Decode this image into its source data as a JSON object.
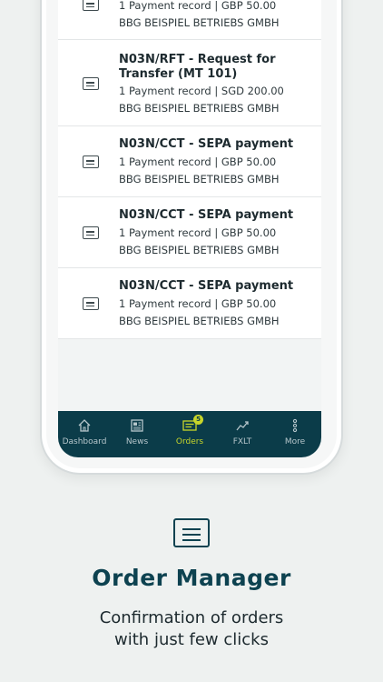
{
  "orders": [
    {
      "title": "",
      "meta": "1 Payment record | GBP 50.00",
      "company": "BBG BEISPIEL BETRIEBS GMBH"
    },
    {
      "title": "N03N/RFT - Request for Transfer (MT 101)",
      "meta": "1 Payment record | SGD 200.00",
      "company": "BBG BEISPIEL BETRIEBS GMBH"
    },
    {
      "title": "N03N/CCT - SEPA payment",
      "meta": "1 Payment record | GBP 50.00",
      "company": "BBG BEISPIEL BETRIEBS GMBH"
    },
    {
      "title": "N03N/CCT - SEPA payment",
      "meta": "1 Payment record | GBP 50.00",
      "company": "BBG BEISPIEL BETRIEBS GMBH"
    },
    {
      "title": "N03N/CCT - SEPA payment",
      "meta": "1 Payment record | GBP 50.00",
      "company": "BBG BEISPIEL BETRIEBS GMBH"
    }
  ],
  "tabs": [
    {
      "label": "Dashboard",
      "icon": "home-icon"
    },
    {
      "label": "News",
      "icon": "newspaper-icon"
    },
    {
      "label": "Orders",
      "icon": "orders-icon",
      "badge": "5",
      "active": true
    },
    {
      "label": "FXLT",
      "icon": "chart-line-icon"
    },
    {
      "label": "More",
      "icon": "more-vertical-icon"
    }
  ],
  "colors": {
    "brand_dark": "#0b3c49",
    "accent": "#c8d62a",
    "background": "#eef1f0"
  },
  "footer": {
    "icon": "order-document-icon",
    "headline": "Order Manager",
    "subline_1": "Confirmation of orders",
    "subline_2": "with just few clicks"
  }
}
